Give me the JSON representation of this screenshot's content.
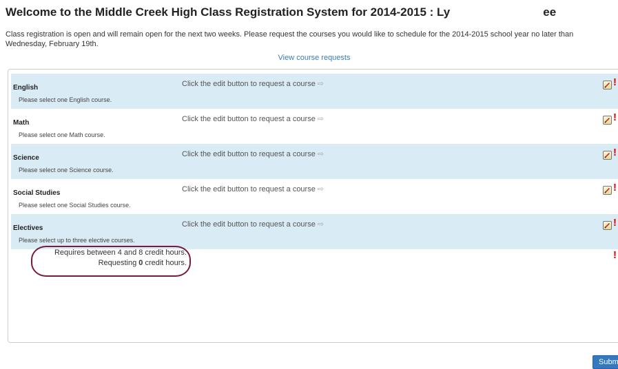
{
  "header": {
    "title": "Welcome to the Middle Creek High Class Registration System for 2014-2015 : Ly",
    "title_tail": "ee"
  },
  "intro": {
    "text": "Class registration is open and will remain open for the next two weeks. Please request the courses you would like to schedule for the 2014-2015 school year no later than Wednesday, February 19th."
  },
  "links": {
    "view_course_requests": "View course requests"
  },
  "subjects": [
    {
      "name": "English",
      "hint": "Click the edit button to request a course",
      "desc": "Please select one English course."
    },
    {
      "name": "Math",
      "hint": "Click the edit button to request a course",
      "desc": "Please select one Math course."
    },
    {
      "name": "Science",
      "hint": "Click the edit button to request a course",
      "desc": "Please select one Science course."
    },
    {
      "name": "Social Studies",
      "hint": "Click the edit button to request a course",
      "desc": "Please select one Social Studies course."
    },
    {
      "name": "Electives",
      "hint": "Click the edit button to request a course",
      "desc": "Please select up to three elective courses."
    }
  ],
  "icons": {
    "arrow": "arrow-right-icon",
    "edit": "edit-icon",
    "warning": "exclamation-icon",
    "arrow_glyph": "⇨",
    "warning_glyph": "!"
  },
  "credits": {
    "requirement": "Requires between 4 and 8 credit hours.",
    "requesting_prefix": "Requesting ",
    "requesting_value": "0",
    "requesting_suffix": " credit hours."
  },
  "actions": {
    "submit_label": "Submit"
  },
  "colors": {
    "row_shade": "#d9ebf4",
    "link": "#3a7ab8",
    "warning": "#e00000",
    "annotation_oval": "#7b1a3a",
    "submit_bg": "#3478c0"
  }
}
